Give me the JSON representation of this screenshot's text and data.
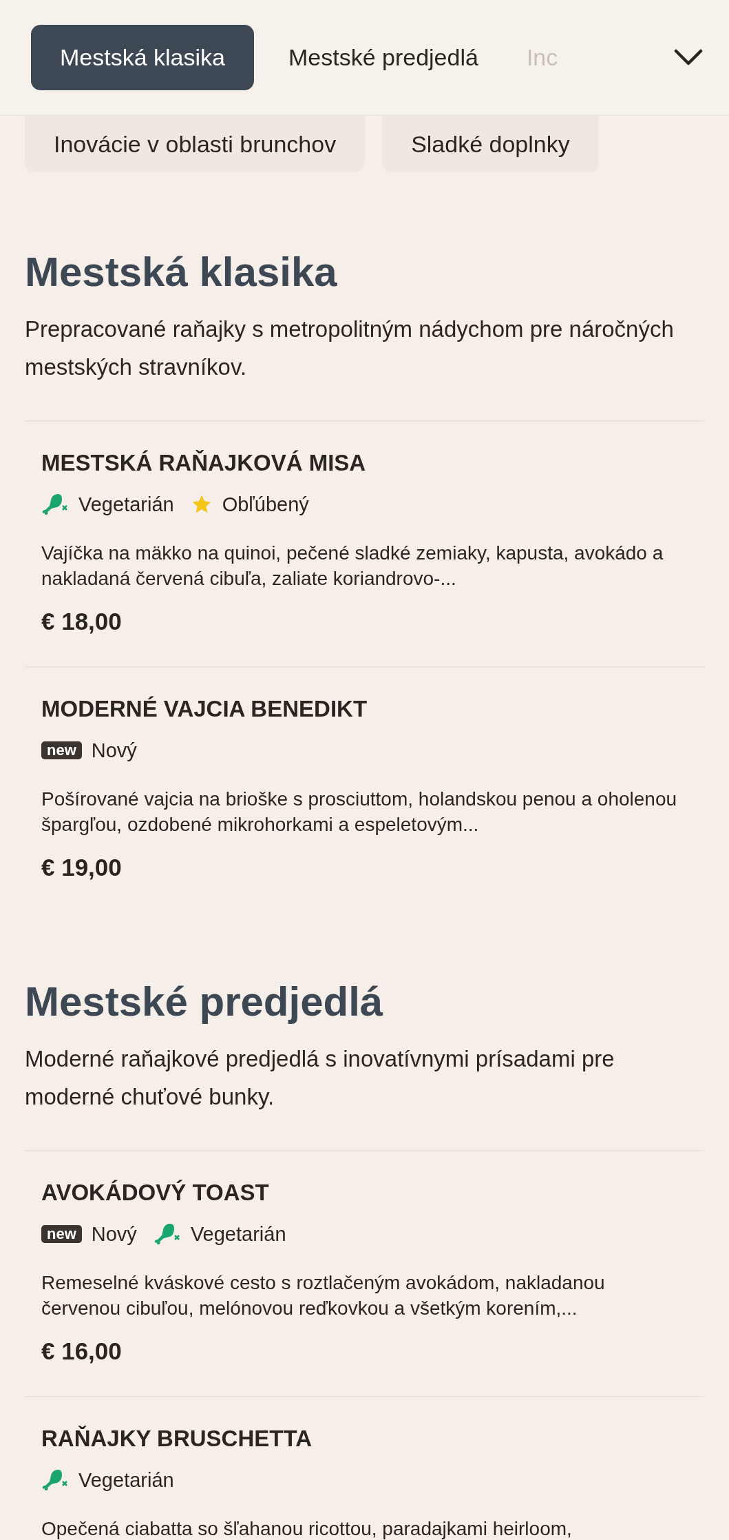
{
  "category_nav": {
    "tabs": [
      {
        "label": "Mestská klasika",
        "selected": true
      },
      {
        "label": "Mestské predjedlá",
        "selected": false
      },
      {
        "label": "Inc",
        "selected": false,
        "faded": true
      }
    ],
    "more_tabs": [
      {
        "label": "Inovácie v oblasti brunchov"
      },
      {
        "label": "Sladké doplnky"
      }
    ]
  },
  "sections": [
    {
      "title": "Mestská klasika",
      "description": "Prepracované raňajky s metropolitným nádychom pre náročných mestských stravníkov.",
      "items": [
        {
          "name": "MESTSKÁ RAŇAJKOVÁ MISA",
          "tags": [
            {
              "kind": "vegetarian",
              "label": "Vegetarián"
            },
            {
              "kind": "popular",
              "label": "Obľúbený"
            }
          ],
          "description": "Vajíčka na mäkko na quinoi, pečené sladké zemiaky, kapusta, avokádo a nakladaná červená cibuľa, zaliate koriandrovo-...",
          "price": "€ 18,00"
        },
        {
          "name": "MODERNÉ VAJCIA BENEDIKT",
          "tags": [
            {
              "kind": "new",
              "badge": "new",
              "label": "Nový"
            }
          ],
          "description": "Pošírované vajcia na brioške s prosciuttom, holandskou penou a oholenou špargľou, ozdobené mikrohorkami a espeletovým...",
          "price": "€ 19,00"
        }
      ]
    },
    {
      "title": "Mestské predjedlá",
      "description": "Moderné raňajkové predjedlá s inovatívnymi prísadami pre moderné chuťové bunky.",
      "items": [
        {
          "name": "AVOKÁDOVÝ TOAST",
          "tags": [
            {
              "kind": "new",
              "badge": "new",
              "label": "Nový"
            },
            {
              "kind": "vegetarian",
              "label": "Vegetarián"
            }
          ],
          "description": "Remeselné kváskové cesto s roztlačeným avokádom, nakladanou červenou cibuľou, melónovou reďkovkou a všetkým korením,...",
          "price": "€ 16,00"
        },
        {
          "name": "RAŇAJKY BRUSCHETTA",
          "tags": [
            {
              "kind": "vegetarian",
              "label": "Vegetarián"
            }
          ],
          "description": "Opečená ciabatta so šľahanou ricottou, paradajkami heirloom,"
        }
      ]
    }
  ]
}
